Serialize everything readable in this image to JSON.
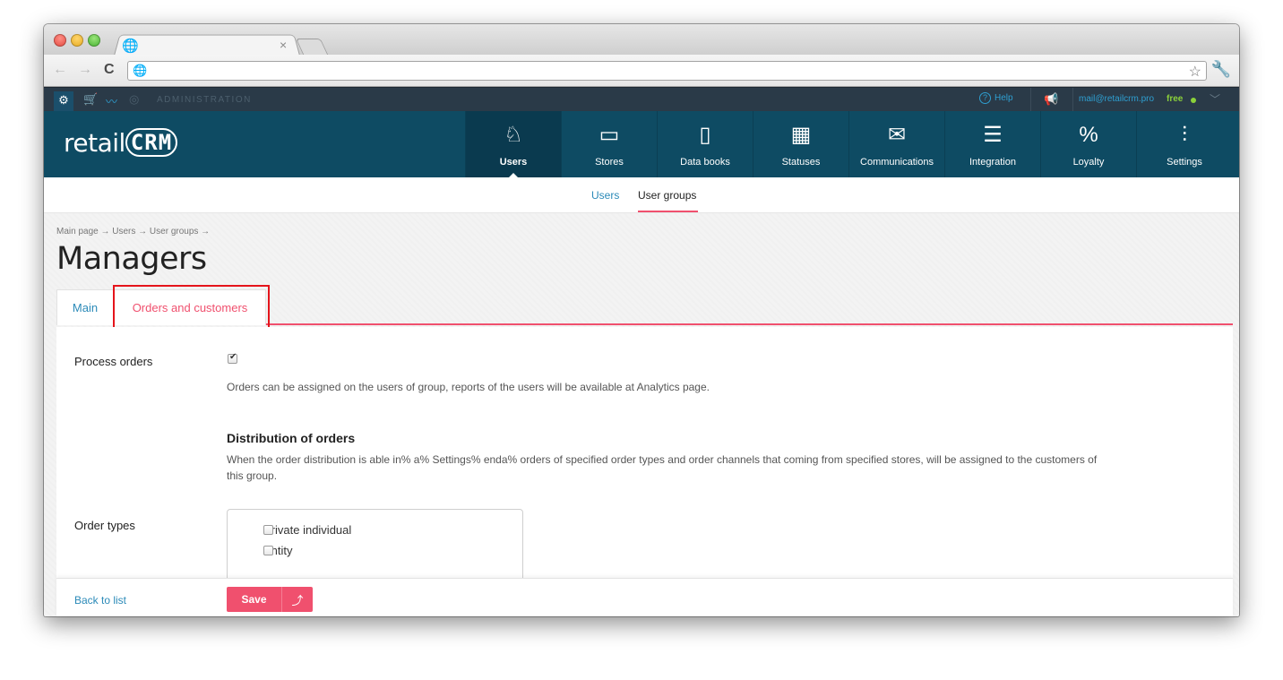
{
  "browser": {
    "tab_close": "×",
    "back": "←",
    "forward": "→",
    "reload": "C",
    "globe": "🌐",
    "star": "☆",
    "wrench": "🔧"
  },
  "adminbar": {
    "label": "ADMINISTRATION",
    "help": "Help",
    "email": "mail@retailcrm.pro",
    "plan": "free"
  },
  "logo": {
    "text": "retail",
    "crm": "CRM"
  },
  "mainnav": {
    "items": [
      {
        "label": "Users",
        "icon": "user-icon",
        "glyph": "♘",
        "active": true
      },
      {
        "label": "Stores",
        "icon": "store-window-icon",
        "glyph": "▭"
      },
      {
        "label": "Data books",
        "icon": "book-icon",
        "glyph": "▯"
      },
      {
        "label": "Statuses",
        "icon": "status-grid-icon",
        "glyph": "▦"
      },
      {
        "label": "Communications",
        "icon": "mail-icon",
        "glyph": "✉"
      },
      {
        "label": "Integration",
        "icon": "integration-lines-icon",
        "glyph": "☰"
      },
      {
        "label": "Loyalty",
        "icon": "percent-tag-icon",
        "glyph": "%"
      },
      {
        "label": "Settings",
        "icon": "sliders-icon",
        "glyph": "⫶"
      }
    ]
  },
  "subnav": {
    "users": "Users",
    "user_groups": "User groups"
  },
  "breadcrumbs": "Main page → Users → User groups →",
  "page_title": "Managers",
  "tabs": {
    "main": "Main",
    "orders": "Orders and customers"
  },
  "form": {
    "process_orders_label": "Process orders",
    "process_orders_help": "Orders can be assigned on the users of group, reports of the users will be available at Analytics page.",
    "distribution_title": "Distribution of orders",
    "distribution_help_1": "When the order distribution is able in% a% Settings% enda% orders of specified order types and order channels that coming from specified stores, will be assigned to the customers of",
    "distribution_help_2": "this group.",
    "order_types_label": "Order types",
    "order_types": [
      "Private individual",
      "Entity"
    ]
  },
  "footer": {
    "back": "Back to list",
    "save": "Save",
    "save_up": "⤴"
  },
  "colors": {
    "accent": "#f0506e",
    "nav": "#0e4b63",
    "link": "#2b8ab8",
    "highlight": "#e5141b"
  }
}
